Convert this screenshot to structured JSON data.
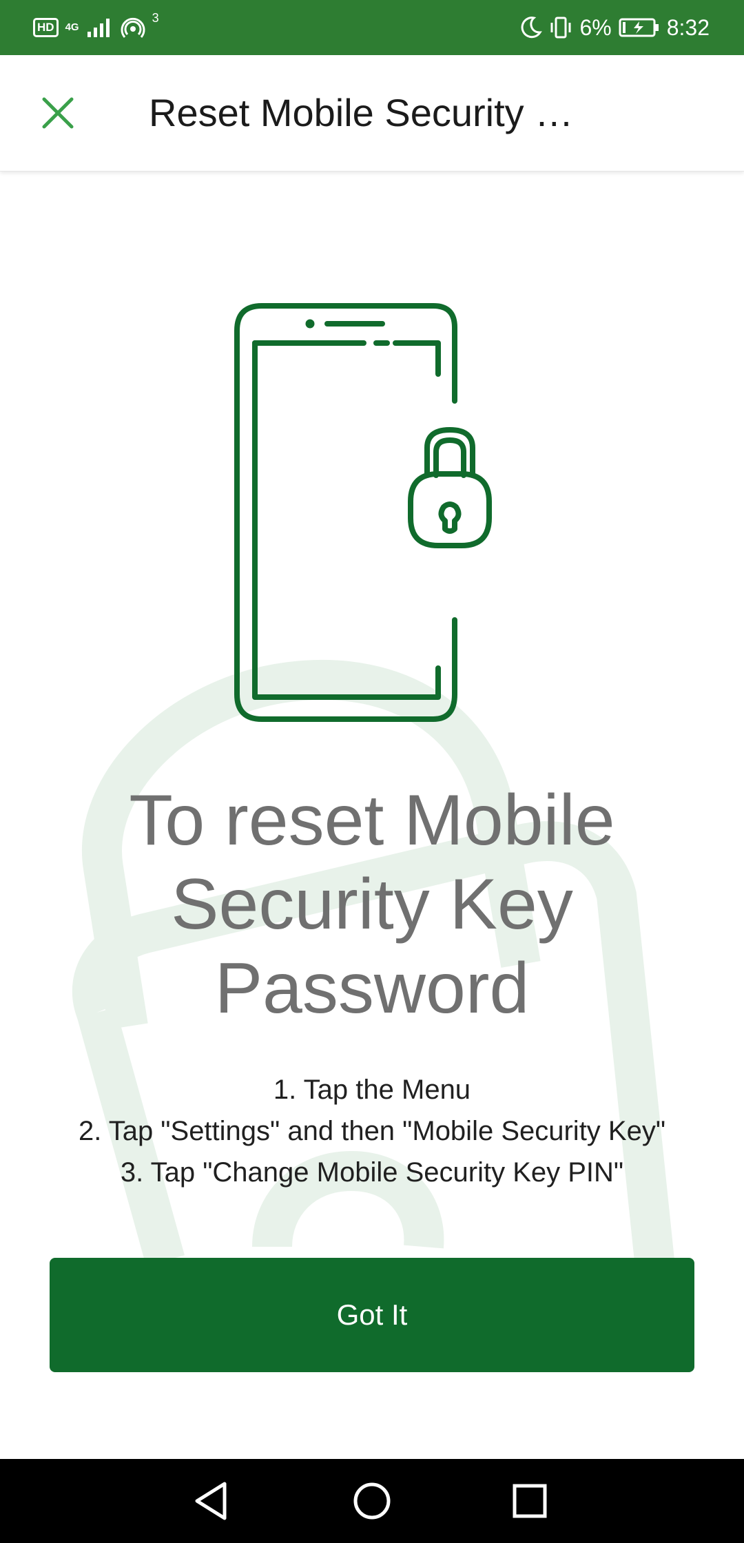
{
  "status_bar": {
    "left": {
      "hd": "HD",
      "network": "4G",
      "hotspot_count": "3"
    },
    "battery_percent": "6%",
    "time": "8:32",
    "icons": [
      "hd-icon",
      "signal-icon",
      "hotspot-icon",
      "moon-icon",
      "vibrate-icon",
      "battery-charging-icon"
    ]
  },
  "app_bar": {
    "title": "Reset Mobile Security …",
    "close_icon": "close-icon"
  },
  "content": {
    "heading": "To reset Mobile Security Key Password",
    "steps": [
      "1. Tap the Menu",
      "2. Tap \"Settings\" and then \"Mobile Security Key\"",
      "3. Tap \"Change Mobile Security Key PIN\""
    ],
    "illustration_icon": "phone-lock-icon",
    "background_icon": "padlock-watermark-icon"
  },
  "button": {
    "label": "Got It"
  },
  "nav": {
    "back": "back-icon",
    "home": "home-icon",
    "recents": "recents-icon"
  },
  "colors": {
    "status_bar": "#2e7d32",
    "brand_green": "#106b2c",
    "close_green": "#3aa04a",
    "heading_gray": "#707070",
    "watermark": "#e8f2ea"
  }
}
